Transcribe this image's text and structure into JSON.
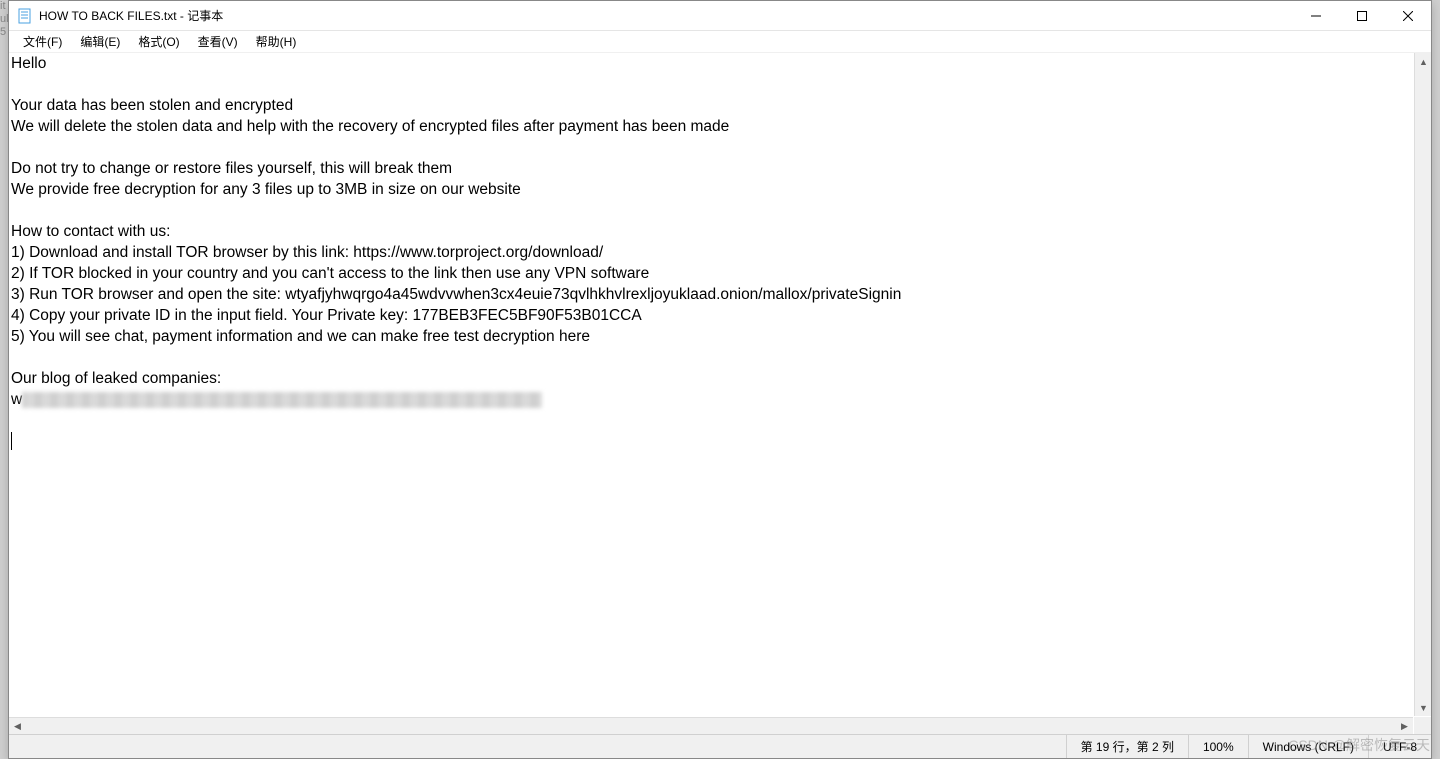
{
  "window": {
    "title": "HOW TO BACK FILES.txt - 记事本"
  },
  "menu": {
    "file": "文件(F)",
    "edit": "编辑(E)",
    "format": "格式(O)",
    "view": "查看(V)",
    "help": "帮助(H)"
  },
  "content": {
    "lines": [
      "Hello",
      "",
      "Your data has been stolen and encrypted",
      "We will delete the stolen data and help with the recovery of encrypted files after payment has been made",
      "",
      "Do not try to change or restore files yourself, this will break them",
      "We provide free decryption for any 3 files up to 3MB in size on our website",
      "",
      "How to contact with us:",
      "1) Download and install TOR browser by this link: https://www.torproject.org/download/",
      "2) If TOR blocked in your country and you can't access to the link then use any VPN software",
      "3) Run TOR browser and open the site: wtyafjyhwqrgo4a45wdvvwhen3cx4euie73qvlhkhvlrexljoyuklaad.onion/mallox/privateSignin",
      "4) Copy your private ID in the input field. Your Private key: 177BEB3FEC5BF90F53B01CCA",
      "5) You will see chat, payment information and we can make free test decryption here",
      "",
      "Our blog of leaked companies:"
    ],
    "redacted_prefix": "w"
  },
  "status": {
    "position": "第 19 行，第 2 列",
    "zoom": "100%",
    "line_ending": "Windows (CRLF)",
    "encoding": "UTF-8"
  },
  "watermark": "CSDN @解密恢复云天",
  "bg_fragments": [
    "it",
    "ull",
    "5"
  ]
}
